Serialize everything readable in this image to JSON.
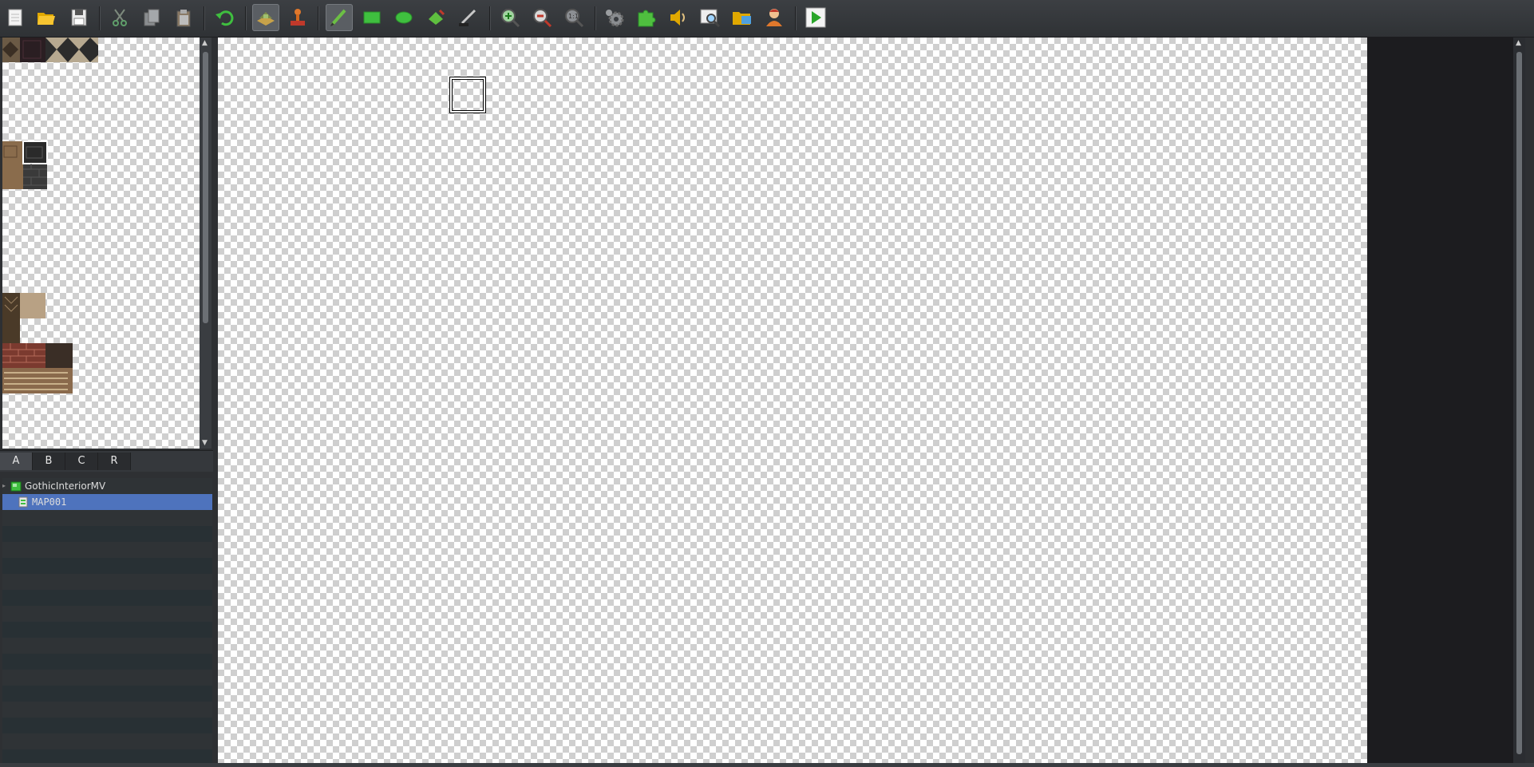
{
  "toolbar": {
    "buttons": [
      {
        "name": "new-project-button",
        "icon": "new-file-icon"
      },
      {
        "name": "open-project-button",
        "icon": "folder-open-icon"
      },
      {
        "name": "save-project-button",
        "icon": "save-icon"
      },
      {
        "name": "cut-button",
        "icon": "scissors-icon"
      },
      {
        "name": "copy-button",
        "icon": "copy-icon"
      },
      {
        "name": "paste-button",
        "icon": "clipboard-icon"
      },
      {
        "name": "undo-button",
        "icon": "undo-icon"
      },
      {
        "name": "map-mode-button",
        "icon": "map-layer-icon",
        "active": true
      },
      {
        "name": "event-mode-button",
        "icon": "event-stamp-icon"
      },
      {
        "name": "pencil-tool-button",
        "icon": "pencil-icon",
        "active": true
      },
      {
        "name": "rectangle-tool-button",
        "icon": "rectangle-icon"
      },
      {
        "name": "ellipse-tool-button",
        "icon": "ellipse-icon"
      },
      {
        "name": "fill-tool-button",
        "icon": "paint-bucket-icon"
      },
      {
        "name": "shadow-pen-button",
        "icon": "shadow-pen-icon"
      },
      {
        "name": "zoom-in-button",
        "icon": "zoom-in-icon"
      },
      {
        "name": "zoom-out-button",
        "icon": "zoom-out-icon"
      },
      {
        "name": "actual-size-button",
        "icon": "zoom-actual-size-icon"
      },
      {
        "name": "database-button",
        "icon": "gear-icon"
      },
      {
        "name": "plugin-manager-button",
        "icon": "puzzle-icon"
      },
      {
        "name": "sound-test-button",
        "icon": "speaker-icon"
      },
      {
        "name": "event-search-button",
        "icon": "search-window-icon"
      },
      {
        "name": "resource-manager-button",
        "icon": "resource-folder-icon"
      },
      {
        "name": "character-generator-button",
        "icon": "character-icon"
      },
      {
        "name": "playtest-button",
        "icon": "play-icon"
      }
    ]
  },
  "tileset_tabs": [
    "A",
    "B",
    "C",
    "R"
  ],
  "selected_tab": "A",
  "map_tree": {
    "project": "GothicInteriorMV",
    "maps": [
      "MAP001"
    ],
    "selected": "MAP001"
  },
  "colors": {
    "toolbar_bg": "#3a3d41",
    "selection": "#4e73bd",
    "canvas_dark": "#1c1c1f",
    "accent_green": "#3fbf3f"
  }
}
